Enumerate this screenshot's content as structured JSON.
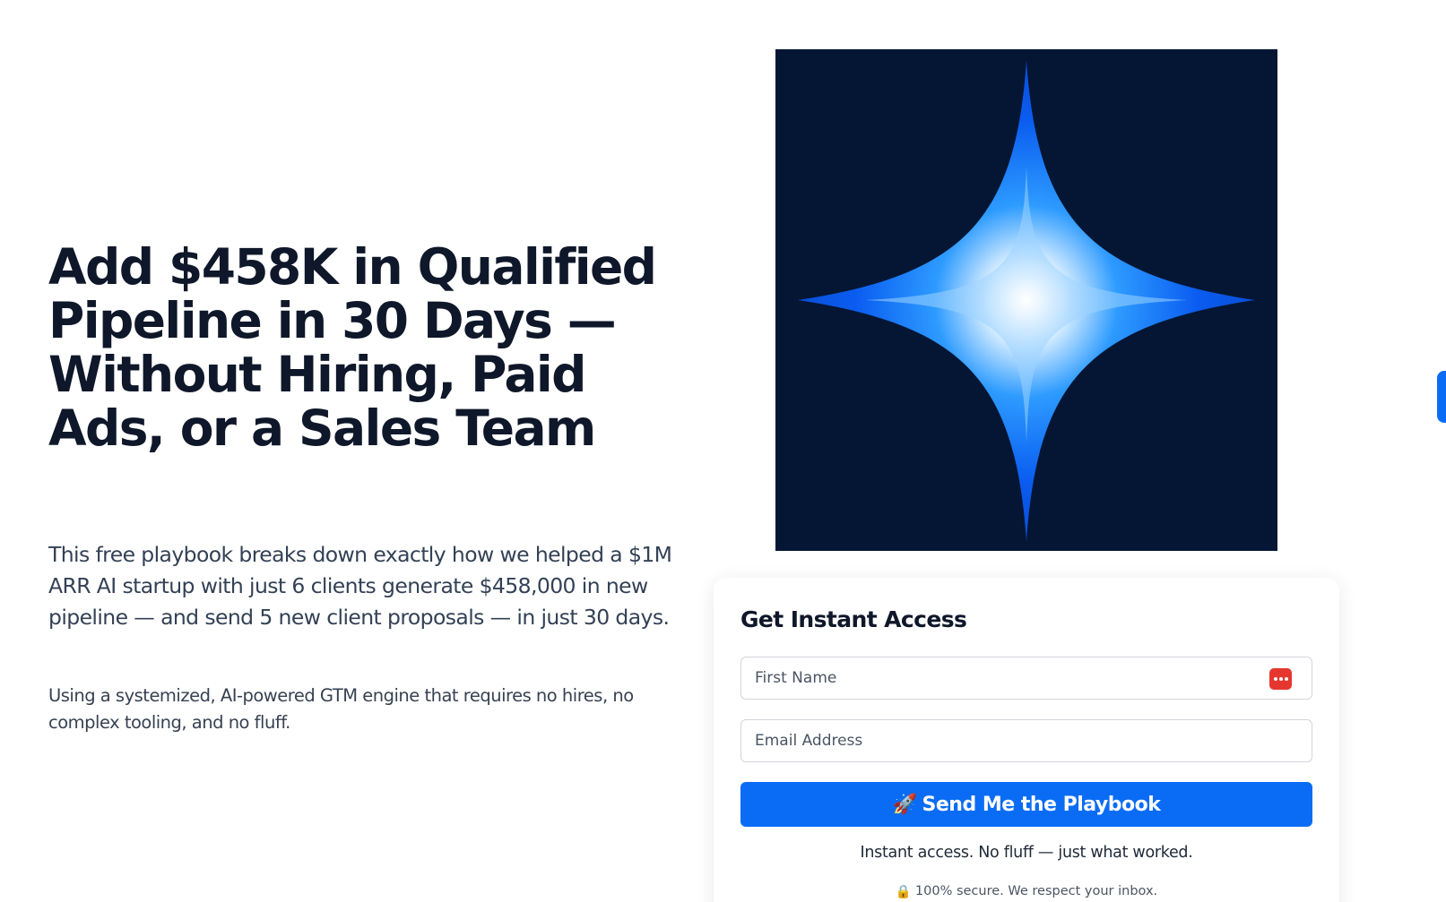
{
  "hero": {
    "title": "Add $458K in Qualified Pipeline in 30 Days — Without Hiring, Paid Ads, or a Sales Team",
    "subtitle": "This free playbook breaks down exactly how we helped a $1M ARR AI startup with just 6 clients generate $458,000 in new pipeline — and send 5 new client proposals — in just 30 days.",
    "note": "Using a systemized, AI-powered GTM engine that requires no hires, no complex tooling, and no fluff."
  },
  "cover": {
    "icon": "sparkle-star-icon",
    "background": "#041634",
    "accent": "#0a6cf5"
  },
  "form": {
    "title": "Get Instant Access",
    "first_name_placeholder": "First Name",
    "email_placeholder": "Email Address",
    "submit_emoji": "🚀",
    "submit_label": "Send Me the Playbook",
    "instant_text": "Instant access. No fluff — just what worked.",
    "secure_emoji": "🔒",
    "secure_text": "100% secure. We respect your inbox."
  },
  "colors": {
    "button": "#0a6cf5",
    "heading": "#0f172a",
    "password_manager_icon": "#e5372f"
  }
}
